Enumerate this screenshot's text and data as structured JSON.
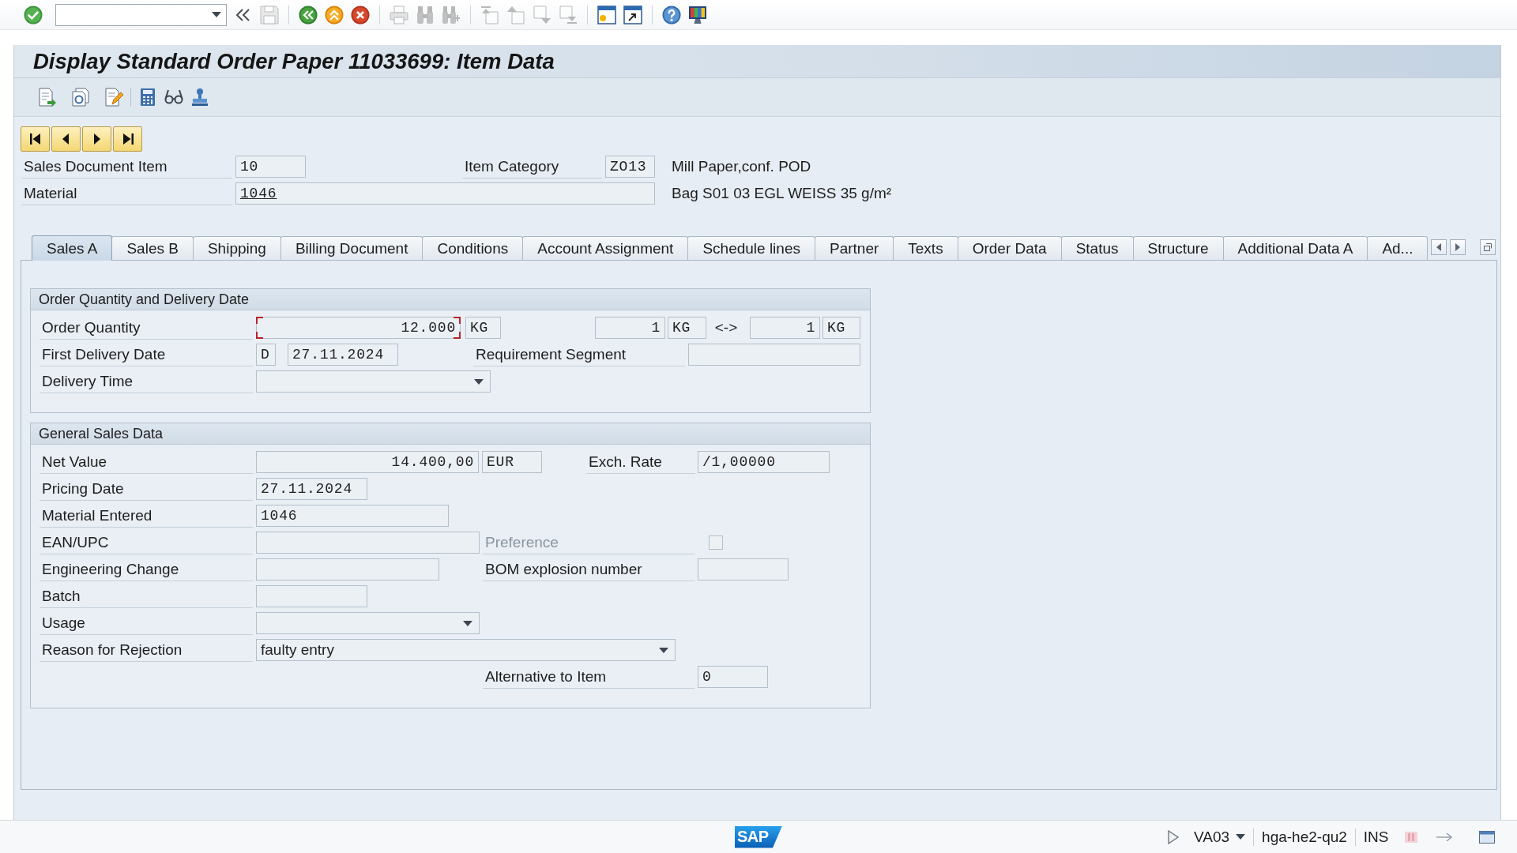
{
  "system_toolbar": {
    "groups": [
      [
        {
          "kind": "enter",
          "disabled": false
        },
        {
          "kind": "command",
          "disabled": false
        },
        {
          "kind": "collapse",
          "disabled": false
        },
        {
          "kind": "save",
          "disabled": true
        }
      ],
      [
        {
          "kind": "back",
          "disabled": false
        },
        {
          "kind": "exit",
          "disabled": false
        },
        {
          "kind": "cancel",
          "disabled": false
        }
      ],
      [
        {
          "kind": "print",
          "disabled": true
        },
        {
          "kind": "find",
          "disabled": true
        },
        {
          "kind": "findnext",
          "disabled": true
        }
      ],
      [
        {
          "kind": "firstpage",
          "disabled": true
        },
        {
          "kind": "prevpage",
          "disabled": true
        },
        {
          "kind": "nextpage",
          "disabled": true
        },
        {
          "kind": "lastpage",
          "disabled": true
        }
      ],
      [
        {
          "kind": "newsession",
          "disabled": false
        },
        {
          "kind": "shortcut",
          "disabled": false
        }
      ],
      [
        {
          "kind": "help",
          "disabled": false
        },
        {
          "kind": "layout",
          "disabled": false
        }
      ]
    ]
  },
  "window": {
    "title": "Display Standard Order Paper 11033699: Item Data"
  },
  "header": {
    "rows": [
      {
        "label": "Sales Document Item",
        "items": [
          {
            "kind": "field",
            "value": "10",
            "focused": false
          },
          {
            "kind": "label",
            "text": "Item Category",
            "disabled": false
          },
          {
            "kind": "field",
            "value": "ZO13",
            "focused": false
          },
          {
            "kind": "text",
            "text": "Mill Paper,conf. POD"
          }
        ]
      },
      {
        "label": "Material",
        "items": [
          {
            "kind": "hotspot",
            "value": "1046",
            "focused": false
          },
          {
            "kind": "text",
            "text": "Bag S01 03 EGL WEISS 35 g/m²"
          }
        ]
      }
    ]
  },
  "tabs": [
    {
      "label": "Sales A",
      "selected": true
    },
    {
      "label": "Sales B",
      "selected": false
    },
    {
      "label": "Shipping",
      "selected": false
    },
    {
      "label": "Billing Document",
      "selected": false
    },
    {
      "label": "Conditions",
      "selected": false
    },
    {
      "label": "Account Assignment",
      "selected": false
    },
    {
      "label": "Schedule lines",
      "selected": false
    },
    {
      "label": "Partner",
      "selected": false
    },
    {
      "label": "Texts",
      "selected": false
    },
    {
      "label": "Order Data",
      "selected": false
    },
    {
      "label": "Status",
      "selected": false
    },
    {
      "label": "Structure",
      "selected": false
    },
    {
      "label": "Additional Data A",
      "selected": false
    },
    {
      "label": "Ad...",
      "selected": false
    }
  ],
  "groups": [
    {
      "title": "Order Quantity and Delivery Date",
      "rows": [
        {
          "label": "Order Quantity",
          "items": [
            {
              "kind": "amount",
              "value": "12.000",
              "focused": true
            },
            {
              "kind": "unit",
              "value": "KG",
              "focused": false
            },
            {
              "kind": "amount",
              "value": "1",
              "focused": false
            },
            {
              "kind": "unit",
              "value": "KG",
              "focused": false
            },
            {
              "kind": "text",
              "text": "<->"
            },
            {
              "kind": "amount",
              "value": "1",
              "focused": false
            },
            {
              "kind": "unit",
              "value": "KG",
              "focused": false
            }
          ]
        },
        {
          "label": "First Delivery Date",
          "items": [
            {
              "kind": "field",
              "value": "D",
              "focused": false
            },
            {
              "kind": "field",
              "value": "27.11.2024",
              "focused": false
            },
            {
              "kind": "label",
              "text": "Requirement Segment",
              "disabled": false
            },
            {
              "kind": "field",
              "focused": false
            }
          ]
        },
        {
          "label": "Delivery Time",
          "items": [
            {
              "kind": "dropdown",
              "focused": false
            }
          ]
        }
      ]
    },
    {
      "title": "General Sales Data",
      "rows": [
        {
          "label": "Net Value",
          "items": [
            {
              "kind": "amount",
              "value": "14.400,00",
              "focused": false
            },
            {
              "kind": "unit",
              "value": "EUR",
              "focused": false
            },
            {
              "kind": "label",
              "text": "Exch. Rate",
              "disabled": false
            },
            {
              "kind": "field",
              "value": "/1,00000",
              "focused": false
            }
          ]
        },
        {
          "label": "Pricing Date",
          "items": [
            {
              "kind": "field",
              "value": "27.11.2024",
              "focused": false
            }
          ]
        },
        {
          "label": "Material Entered",
          "items": [
            {
              "kind": "field",
              "value": "1046",
              "focused": false
            }
          ]
        },
        {
          "label": "EAN/UPC",
          "items": [
            {
              "kind": "field",
              "focused": false
            },
            {
              "kind": "label",
              "text": "Preference",
              "disabled": true
            },
            {
              "kind": "checkbox",
              "checked": false,
              "disabled": true
            }
          ]
        },
        {
          "label": "Engineering Change",
          "items": [
            {
              "kind": "field",
              "focused": false
            },
            {
              "kind": "label",
              "text": "BOM explosion number",
              "disabled": false
            },
            {
              "kind": "field",
              "focused": false
            }
          ]
        },
        {
          "label": "Batch",
          "items": [
            {
              "kind": "field",
              "focused": false
            }
          ]
        },
        {
          "label": "Usage",
          "items": [
            {
              "kind": "dropdown",
              "focused": false
            }
          ]
        },
        {
          "label": "Reason for Rejection",
          "items": [
            {
              "kind": "dropdown",
              "value": "faulty entry",
              "focused": false
            }
          ]
        },
        {
          "items": [
            {
              "kind": "label",
              "text": "Alternative to Item",
              "disabled": false
            },
            {
              "kind": "field",
              "value": "0",
              "focused": false
            }
          ]
        }
      ]
    }
  ],
  "status_bar": {
    "logo": "SAP",
    "transaction": "VA03",
    "server": "hga-he2-qu2",
    "mode": "INS"
  }
}
